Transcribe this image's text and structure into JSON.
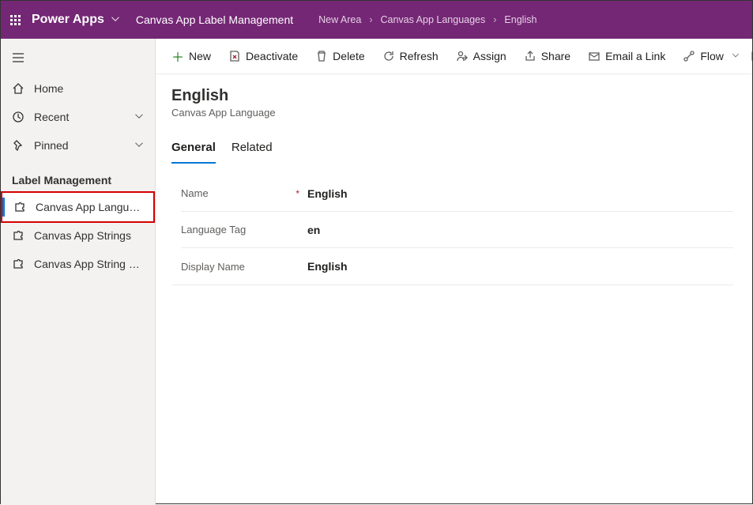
{
  "header": {
    "app_name": "Power Apps",
    "app_subtitle": "Canvas App Label Management",
    "breadcrumb": [
      "New Area",
      "Canvas App Languages",
      "English"
    ]
  },
  "sidebar": {
    "home": "Home",
    "recent": "Recent",
    "pinned": "Pinned",
    "group_header": "Label Management",
    "items": [
      "Canvas App Languag…",
      "Canvas App Strings",
      "Canvas App String V…"
    ]
  },
  "commands": {
    "new": "New",
    "deactivate": "Deactivate",
    "delete": "Delete",
    "refresh": "Refresh",
    "assign": "Assign",
    "share": "Share",
    "email_link": "Email a Link",
    "flow": "Flow"
  },
  "record": {
    "title": "English",
    "entity": "Canvas App Language",
    "tabs": {
      "general": "General",
      "related": "Related"
    },
    "fields": {
      "name_label": "Name",
      "name_value": "English",
      "tag_label": "Language Tag",
      "tag_value": "en",
      "display_label": "Display Name",
      "display_value": "English"
    }
  }
}
